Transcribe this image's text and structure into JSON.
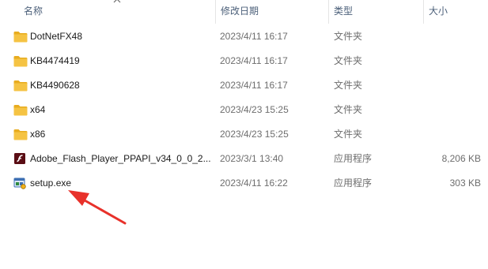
{
  "columns": {
    "name": "名称",
    "date": "修改日期",
    "type": "类型",
    "size": "大小"
  },
  "files": [
    {
      "name": "DotNetFX48",
      "date": "2023/4/11 16:17",
      "type": "文件夹",
      "size": "",
      "icon": "folder-icon"
    },
    {
      "name": "KB4474419",
      "date": "2023/4/11 16:17",
      "type": "文件夹",
      "size": "",
      "icon": "folder-icon"
    },
    {
      "name": "KB4490628",
      "date": "2023/4/11 16:17",
      "type": "文件夹",
      "size": "",
      "icon": "folder-icon"
    },
    {
      "name": "x64",
      "date": "2023/4/23 15:25",
      "type": "文件夹",
      "size": "",
      "icon": "folder-icon"
    },
    {
      "name": "x86",
      "date": "2023/4/23 15:25",
      "type": "文件夹",
      "size": "",
      "icon": "folder-icon"
    },
    {
      "name": "Adobe_Flash_Player_PPAPI_v34_0_0_2...",
      "date": "2023/3/1 13:40",
      "type": "应用程序",
      "size": "8,206 KB",
      "icon": "flash-app-icon"
    },
    {
      "name": "setup.exe",
      "date": "2023/4/11 16:22",
      "type": "应用程序",
      "size": "303 KB",
      "icon": "setup-app-icon"
    }
  ],
  "colors": {
    "folder": "#f5c343",
    "folder_dark": "#e8ac1f",
    "arrow": "#e8312a"
  }
}
